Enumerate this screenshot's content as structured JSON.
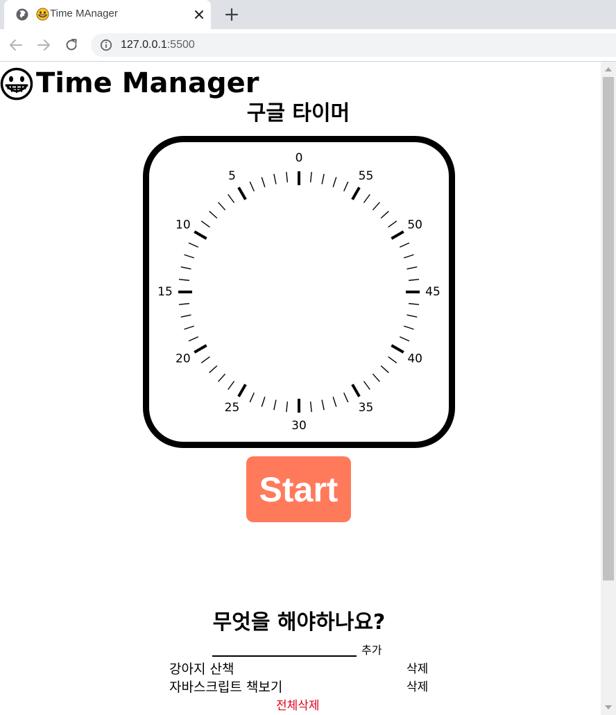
{
  "browser": {
    "tab": {
      "emoji": "😁",
      "title": "Time MAnager",
      "icon": "globe-icon"
    },
    "url": {
      "host": "127.0.0.1",
      "port": ":5500"
    }
  },
  "page": {
    "logo_emoji": "😁",
    "title": "Time Manager",
    "timer": {
      "heading": "구글 타이머",
      "dial_labels": [
        "0",
        "55",
        "50",
        "45",
        "40",
        "35",
        "30",
        "25",
        "20",
        "15",
        "10",
        "5"
      ],
      "start_label": "Start",
      "accent_color": "#ff7a5b"
    },
    "todo": {
      "heading": "무엇을 해야하나요?",
      "input_value": "",
      "add_label": "추가",
      "items": [
        {
          "text": "강아지 산책",
          "delete_label": "삭제"
        },
        {
          "text": "자바스크립트 책보기",
          "delete_label": "삭제"
        }
      ],
      "clear_all_label": "전체삭제",
      "clear_all_color": "#e0001a"
    }
  }
}
